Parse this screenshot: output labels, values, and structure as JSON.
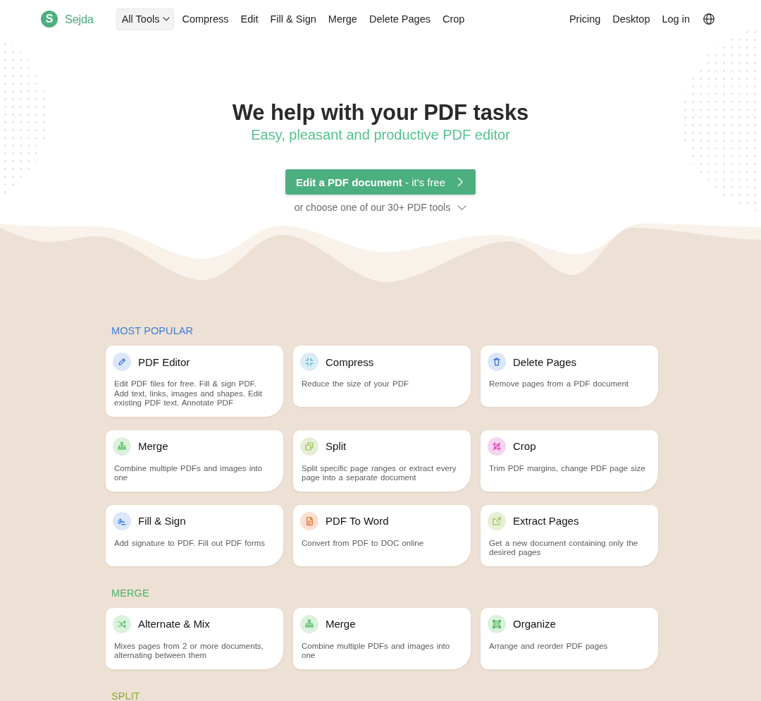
{
  "header": {
    "logo": {
      "mark": "S",
      "name": "Sejda"
    },
    "nav": [
      {
        "label": "All Tools",
        "kind": "dropdown"
      },
      {
        "label": "Compress",
        "kind": "link"
      },
      {
        "label": "Edit",
        "kind": "link"
      },
      {
        "label": "Fill & Sign",
        "kind": "link"
      },
      {
        "label": "Merge",
        "kind": "link"
      },
      {
        "label": "Delete Pages",
        "kind": "link"
      },
      {
        "label": "Crop",
        "kind": "link"
      }
    ],
    "account_nav": [
      {
        "label": "Pricing"
      },
      {
        "label": "Desktop"
      },
      {
        "label": "Log in"
      }
    ]
  },
  "hero": {
    "title": "We help with your PDF tasks",
    "subtitle": "Easy, pleasant and productive PDF editor",
    "cta": "**Edit a PDF document** - it's free",
    "more_tools": "or choose one of our 30+ PDF tools"
  },
  "sections": [
    {
      "title": "MOST POPULAR",
      "color": "#3b7fdc",
      "cards": [
        {
          "kind": "edit",
          "title": "PDF Editor",
          "description": "Edit PDF files for free. Fill & sign PDF. Add text, links, images and shapes. Edit existing PDF text. Annotate PDF",
          "color": "#dce7f9"
        },
        {
          "kind": "compress",
          "title": "Compress",
          "description": "Reduce the size of your PDF",
          "color": "#dbedf4"
        },
        {
          "kind": "delete",
          "title": "Delete Pages",
          "description": "Remove pages from a PDF document",
          "color": "#dce6f8"
        },
        {
          "kind": "merge",
          "title": "Merge",
          "description": "Combine multiple PDFs and images into one",
          "color": "#dcf0de"
        },
        {
          "kind": "split",
          "title": "Split",
          "description": "Split specific page ranges or extract every page into a separate document",
          "color": "#e6efd6"
        },
        {
          "kind": "crop",
          "title": "Crop",
          "description": "Trim PDF margins, change PDF page size",
          "color": "#f5d4ee"
        },
        {
          "kind": "sign",
          "title": "Fill & Sign",
          "description": "Add signature to PDF. Fill out PDF forms",
          "color": "#dce7f9"
        },
        {
          "kind": "convert",
          "title": "PDF To Word",
          "description": "Convert from PDF to DOC online",
          "color": "#fbe0d1"
        },
        {
          "kind": "extract",
          "title": "Extract Pages",
          "description": "Get a new document containing only the desired pages",
          "color": "#e6efd6"
        }
      ]
    },
    {
      "title": "MERGE",
      "color": "#4cb46a",
      "cards": [
        {
          "kind": "mix",
          "title": "Alternate & Mix",
          "description": "Mixes pages from 2 or more documents, alternating between them",
          "color": "#dcf0de"
        },
        {
          "kind": "merge",
          "title": "Merge",
          "description": "Combine multiple PDFs and images into one",
          "color": "#dcf0de"
        },
        {
          "kind": "organize",
          "title": "Organize",
          "description": "Arrange and reorder PDF pages",
          "color": "#dcf0de"
        }
      ]
    },
    {
      "title": "SPLIT",
      "color": "#8aae3a"
    }
  ]
}
